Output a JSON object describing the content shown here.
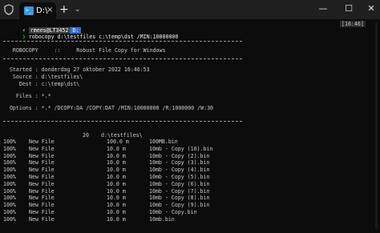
{
  "titlebar": {
    "tab_title": "D:\\",
    "tab_close": "×",
    "tab_icon_label": ">_",
    "new_tab": "+",
    "dropdown": "⌄",
    "minimize": "—",
    "maximize": "☐",
    "close": "✕"
  },
  "prompt": {
    "bolt": "⚡",
    "user": "rmees@LT3452",
    "dir": "D:",
    "time": "[16:46]",
    "arrow": "❯",
    "command": "robocopy d:\\testfiles c:\\temp\\dst /MIN:10000000"
  },
  "header": {
    "title_line": "   ROBOCOPY     ::     Robust File Copy for Windows",
    "started": "  Started : donderdag 27 oktober 2022 16:46:53",
    "source": "   Source : d:\\testfiles\\",
    "dest": "     Dest : c:\\temp\\dst\\",
    "files": "    Files : *.*",
    "options": "  Options : *.* /DCOPY:DA /COPY:DAT /MIN:10000000 /R:1000000 /W:30"
  },
  "dir_line": {
    "count": "20",
    "path": "d:\\testfiles\\"
  },
  "files": [
    {
      "percent": "100%",
      "status": "New File",
      "size": "100.0 m",
      "name": "100MB.bin"
    },
    {
      "percent": "100%",
      "status": "New File",
      "size": "10.0 m",
      "name": "10mb - Copy (10).bin"
    },
    {
      "percent": "100%",
      "status": "New File",
      "size": "10.0 m",
      "name": "10mb - Copy (2).bin"
    },
    {
      "percent": "100%",
      "status": "New File",
      "size": "10.0 m",
      "name": "10mb - Copy (3).bin"
    },
    {
      "percent": "100%",
      "status": "New File",
      "size": "10.0 m",
      "name": "10mb - Copy (4).bin"
    },
    {
      "percent": "100%",
      "status": "New File",
      "size": "10.0 m",
      "name": "10mb - Copy (5).bin"
    },
    {
      "percent": "100%",
      "status": "New File",
      "size": "10.0 m",
      "name": "10mb - Copy (6).bin"
    },
    {
      "percent": "100%",
      "status": "New File",
      "size": "10.0 m",
      "name": "10mb - Copy (7).bin"
    },
    {
      "percent": "100%",
      "status": "New File",
      "size": "10.0 m",
      "name": "10mb - Copy (8).bin"
    },
    {
      "percent": "100%",
      "status": "New File",
      "size": "10.0 m",
      "name": "10mb - Copy (9).bin"
    },
    {
      "percent": "100%",
      "status": "New File",
      "size": "10.0 m",
      "name": "10mb - Copy.bin"
    },
    {
      "percent": "100%",
      "status": "New File",
      "size": "10.0 m",
      "name": "10mb.bin"
    }
  ],
  "colors": {
    "background": "#0c0c0c",
    "titlebar": "#1f1f1f",
    "text": "#cccccc",
    "prompt_dir_bg": "#2f6fd6",
    "arrow": "#16c60c"
  }
}
